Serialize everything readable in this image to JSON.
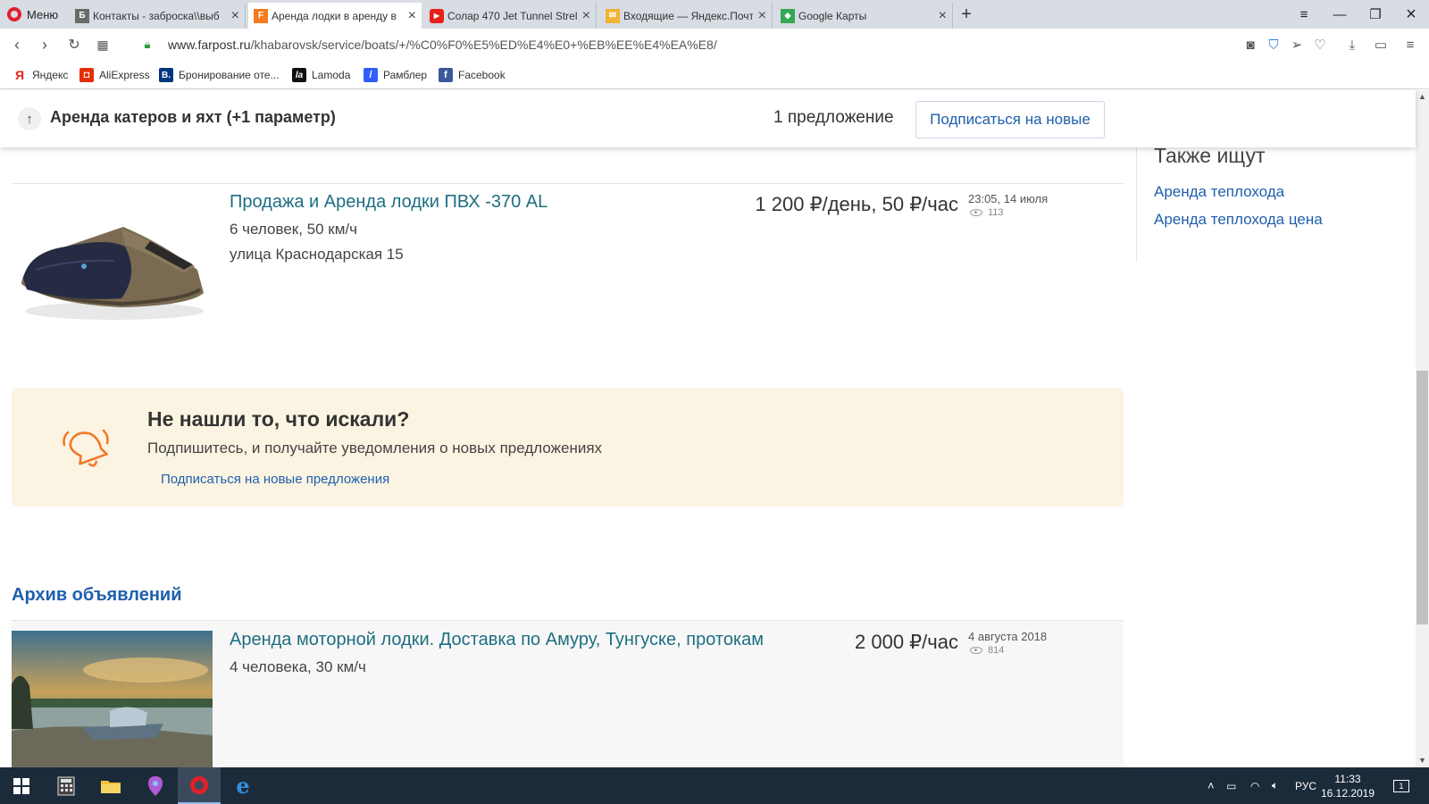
{
  "browser": {
    "menu_label": "Меню",
    "tabs": [
      {
        "title": "Контакты - заброска\\\\выб",
        "favicon": "tab-favicon-contacts",
        "color": "#6b6b6b",
        "glyph": "Б"
      },
      {
        "title": "Аренда лодки в аренду в",
        "favicon": "tab-favicon-farpost",
        "color": "#f47b20",
        "glyph": "F"
      },
      {
        "title": "Солар 470 Jet Tunnel Strel",
        "favicon": "tab-favicon-youtube",
        "color": "#e62117",
        "glyph": "▶"
      },
      {
        "title": "Входящие — Яндекс.Почт",
        "favicon": "tab-favicon-yandex-mail",
        "color": "#f2b233",
        "glyph": "✉"
      },
      {
        "title": "Google Карты",
        "favicon": "tab-favicon-google-maps",
        "color": "#34a853",
        "glyph": "◆"
      }
    ],
    "url_host": "www.farpost.ru",
    "url_path": "/khabarovsk/service/boats/+/%C0%F0%E5%ED%E4%E0+%EB%EE%E4%EA%E8/",
    "bookmarks": [
      {
        "label": "Яндекс",
        "glyph": "Я",
        "color": "#ffffff",
        "text": "#e52620"
      },
      {
        "label": "AliExpress",
        "glyph": "◘",
        "color": "#e62e04",
        "text": "#ffffff"
      },
      {
        "label": "Бронирование оте...",
        "glyph": "B.",
        "color": "#003580",
        "text": "#ffffff"
      },
      {
        "label": "Lamoda",
        "glyph": "la",
        "color": "#111111",
        "text": "#ffffff"
      },
      {
        "label": "Рамблер",
        "glyph": "/",
        "color": "#315efb",
        "text": "#ffffff"
      },
      {
        "label": "Facebook",
        "glyph": "f",
        "color": "#3b5998",
        "text": "#ffffff"
      }
    ]
  },
  "header": {
    "filter_title": "Аренда катеров и яхт (+1 параметр)",
    "offers_count": "1 предложение",
    "subscribe_label": "Подписаться на новые"
  },
  "listings": [
    {
      "title": "Продажа и Аренда лодки ПВХ -370 AL",
      "lines": [
        "6 человек, 50 км/ч",
        "улица Краснодарская 15"
      ],
      "price": "1 200 ₽/день, 50 ₽/час",
      "date": "23:05, 14 июля",
      "views": "113"
    }
  ],
  "sidebar": {
    "title": "Также ищут",
    "links": [
      "Аренда теплохода",
      "Аренда теплохода цена"
    ]
  },
  "promo": {
    "title": "Не нашли то, что искали?",
    "text": "Подпишитесь, и получайте уведомления о новых предложениях",
    "link": "Подписаться на новые предложения"
  },
  "archive": {
    "title": "Архив объявлений",
    "items": [
      {
        "title": "Аренда моторной лодки. Доставка по Амуру, Тунгуске, протокам",
        "lines": [
          "4 человека, 30 км/ч"
        ],
        "price": "2 000 ₽/час",
        "date": "4 августа 2018",
        "views": "814"
      }
    ]
  },
  "taskbar": {
    "language": "РУС",
    "time": "11:33",
    "date": "16.12.2019",
    "notifications": "1"
  }
}
